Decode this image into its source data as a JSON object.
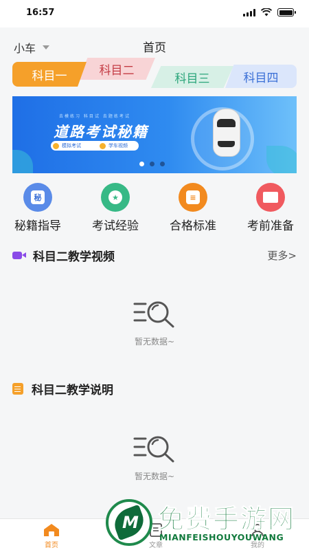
{
  "status_bar": {
    "time": "16:57"
  },
  "header": {
    "car_type": "小车",
    "title": "首页"
  },
  "subjects": [
    {
      "label": "科目一"
    },
    {
      "label": "科目二"
    },
    {
      "label": "科目三"
    },
    {
      "label": "科目四"
    }
  ],
  "banner": {
    "small_text": "去模练习  科目试 去题练考试",
    "title": "道路考试秘籍",
    "pills": [
      "模拟考试",
      "学车视频"
    ],
    "page_count": 3,
    "active_page": 1
  },
  "quick_actions": [
    {
      "label": "秘籍指导",
      "icon": "secret-book-icon",
      "glyph": "秘"
    },
    {
      "label": "考试经验",
      "icon": "star-badge-icon",
      "glyph": "★"
    },
    {
      "label": "合格标准",
      "icon": "document-icon",
      "glyph": "≡"
    },
    {
      "label": "考前准备",
      "icon": "monitor-icon",
      "glyph": ""
    }
  ],
  "video_section": {
    "title": "科目二教学视频",
    "more": "更多>",
    "empty_text": "暂无数据~"
  },
  "intro_section": {
    "title": "科目二教学说明",
    "empty_text": "暂无数据~"
  },
  "tab_bar": [
    {
      "label": "首页",
      "active": true
    },
    {
      "label": "文章",
      "active": false
    },
    {
      "label": "我的",
      "active": false
    }
  ],
  "watermark": {
    "title": "免费手游网",
    "subtitle": "MIANFEISHOUYOUWANG"
  },
  "colors": {
    "accent": "#f28a1f",
    "tab_orange": "#f5a02a",
    "video_purple": "#8a4be8"
  }
}
